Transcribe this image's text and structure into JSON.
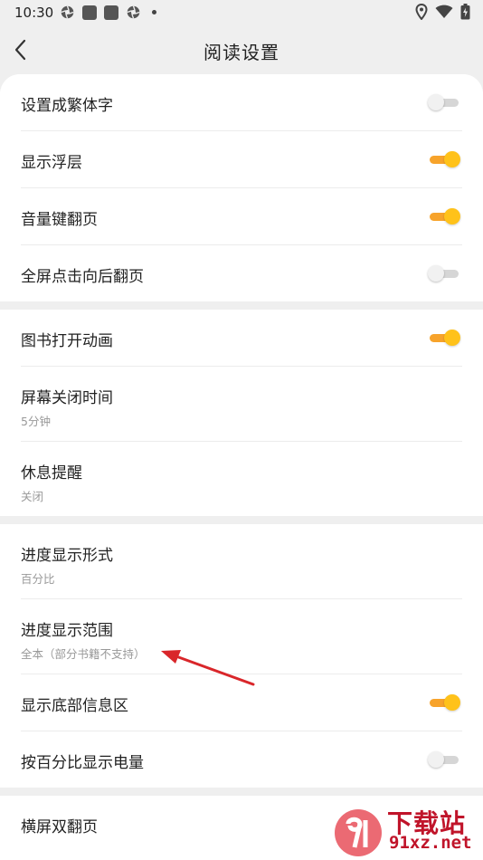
{
  "status_bar": {
    "time": "10:30"
  },
  "header": {
    "title": "阅读设置"
  },
  "groups": [
    {
      "items": [
        {
          "label": "设置成繁体字",
          "toggle": "off"
        },
        {
          "label": "显示浮层",
          "toggle": "on"
        },
        {
          "label": "音量键翻页",
          "toggle": "on"
        },
        {
          "label": "全屏点击向后翻页",
          "toggle": "off"
        }
      ]
    },
    {
      "items": [
        {
          "label": "图书打开动画",
          "toggle": "on"
        },
        {
          "label": "屏幕关闭时间",
          "value": "5分钟"
        },
        {
          "label": "休息提醒",
          "value": "关闭"
        }
      ]
    },
    {
      "items": [
        {
          "label": "进度显示形式",
          "value": "百分比"
        },
        {
          "label": "进度显示范围",
          "value": "全本（部分书籍不支持）"
        },
        {
          "label": "显示底部信息区",
          "toggle": "on"
        },
        {
          "label": "按百分比显示电量",
          "toggle": "off"
        }
      ]
    },
    {
      "items": [
        {
          "label": "横屏双翻页"
        }
      ]
    }
  ],
  "watermark": {
    "top": "下载站",
    "bottom": "91xz.net"
  },
  "colors": {
    "toggle_on_track": "#f7a32b",
    "toggle_on_knob": "#ffc21a",
    "toggle_off_track": "#d6d6d6",
    "annotation_arrow": "#d9262a",
    "watermark": "#c0142a"
  }
}
